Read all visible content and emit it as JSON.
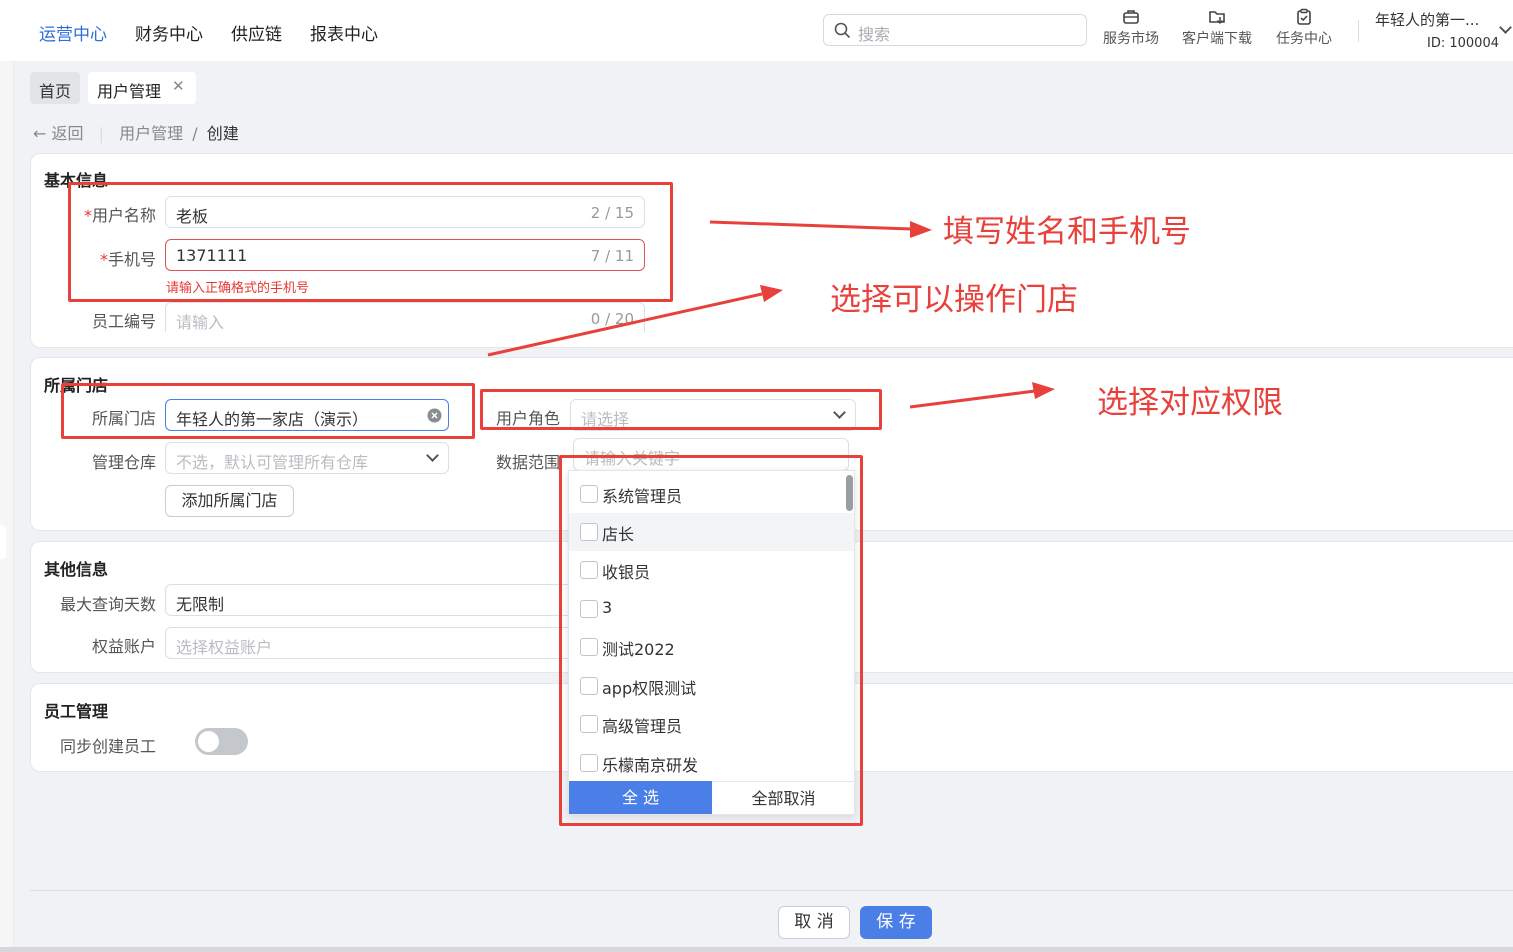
{
  "nav": {
    "items": [
      "运营中心",
      "财务中心",
      "供应链",
      "报表中心"
    ],
    "search_placeholder": "搜索",
    "tools": [
      "服务市场",
      "客户端下载",
      "任务中心"
    ],
    "user_name": "年轻人的第一...",
    "user_id": "ID: 100004"
  },
  "tabs": {
    "home": "首页",
    "user": "用户管理"
  },
  "breadcrumb": {
    "back": "返回",
    "parent": "用户管理",
    "sep": "/",
    "current": "创建"
  },
  "basic": {
    "title": "基本信息",
    "name_label": "用户名称",
    "name_value": "老板",
    "name_count": "2 / 15",
    "phone_label": "手机号",
    "phone_value": "1371111",
    "phone_count": "7 / 11",
    "phone_error": "请输入正确格式的手机号",
    "empno_label": "员工编号",
    "empno_placeholder": "请输入",
    "empno_count": "0 / 20",
    "required_mark": "*"
  },
  "store": {
    "title": "所属门店",
    "store_label": "所属门店",
    "store_value": "年轻人的第一家店（演示）",
    "warehouse_label": "管理仓库",
    "warehouse_placeholder": "不选，默认可管理所有仓库",
    "add_store_button": "添加所属门店",
    "role_label": "用户角色",
    "role_placeholder": "请选择",
    "scope_label": "数据范围"
  },
  "other": {
    "title": "其他信息",
    "maxdays_label": "最大查询天数",
    "maxdays_value": "无限制",
    "equity_label": "权益账户",
    "equity_placeholder": "选择权益账户"
  },
  "staff": {
    "title": "员工管理",
    "sync_label": "同步创建员工",
    "sync_on": false
  },
  "dropdown": {
    "search_placeholder": "请输入关键字",
    "options": [
      "系统管理员",
      "店长",
      "收银员",
      "3",
      "测试2022",
      "app权限测试",
      "高级管理员",
      "乐檬南京研发"
    ],
    "select_all": "全 选",
    "deselect_all": "全部取消"
  },
  "annotations": {
    "fill_name_phone": "填写姓名和手机号",
    "select_store": "选择可以操作门店",
    "select_role": "选择对应权限",
    "color": "#e8413b"
  },
  "footer": {
    "cancel": "取 消",
    "save": "保 存"
  },
  "colors": {
    "primary": "#4a7fe8",
    "error": "#e53935",
    "annotation": "#e8413b"
  }
}
